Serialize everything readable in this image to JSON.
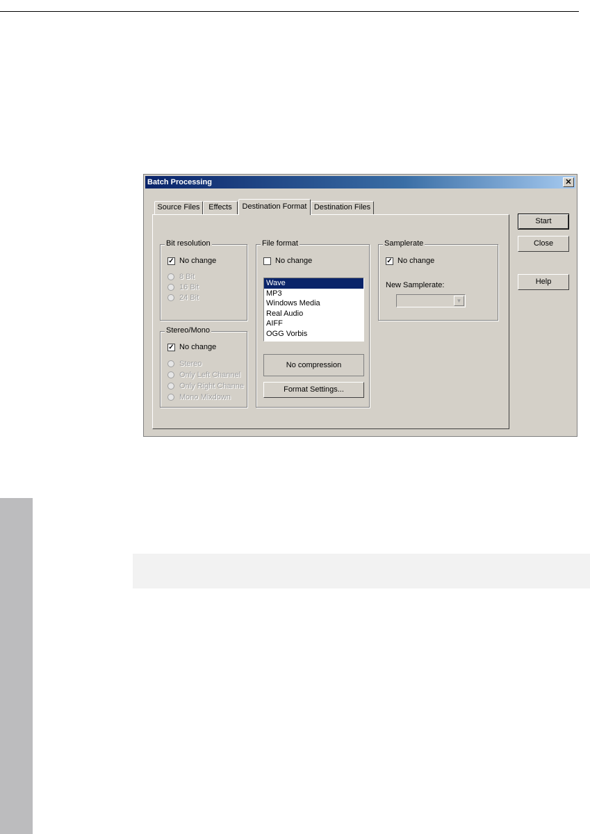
{
  "dialog": {
    "title": "Batch Processing",
    "close_label": "✕"
  },
  "tabs": [
    {
      "label": "Source Files",
      "active": false
    },
    {
      "label": "Effects",
      "active": false
    },
    {
      "label": "Destination Format",
      "active": true
    },
    {
      "label": "Destination Files",
      "active": false
    }
  ],
  "bit_resolution": {
    "label": "Bit resolution",
    "no_change_label": "No change",
    "no_change_checked": true,
    "options": [
      "8 Bit",
      "16 Bit",
      "24 Bit"
    ]
  },
  "stereo_mono": {
    "label": "Stereo/Mono",
    "no_change_label": "No change",
    "no_change_checked": true,
    "options": [
      "Stereo",
      "Only Left Channel",
      "Only Right Channe",
      "Mono Mixdown"
    ]
  },
  "file_format": {
    "label": "File format",
    "no_change_label": "No change",
    "no_change_checked": false,
    "items": [
      "Wave",
      "MP3",
      "Windows Media",
      "Real Audio",
      "AIFF",
      "OGG Vorbis"
    ],
    "selected": "Wave",
    "compression_label": "No compression",
    "settings_button": "Format Settings..."
  },
  "samplerate": {
    "label": "Samplerate",
    "no_change_label": "No change",
    "no_change_checked": true,
    "new_label": "New Samplerate:",
    "new_value": ""
  },
  "buttons": {
    "start": "Start",
    "close": "Close",
    "help": "Help"
  },
  "colors": {
    "dialog_face": "#d4d0c8",
    "title_bar": "#0a246a",
    "selection": "#0a246a"
  }
}
